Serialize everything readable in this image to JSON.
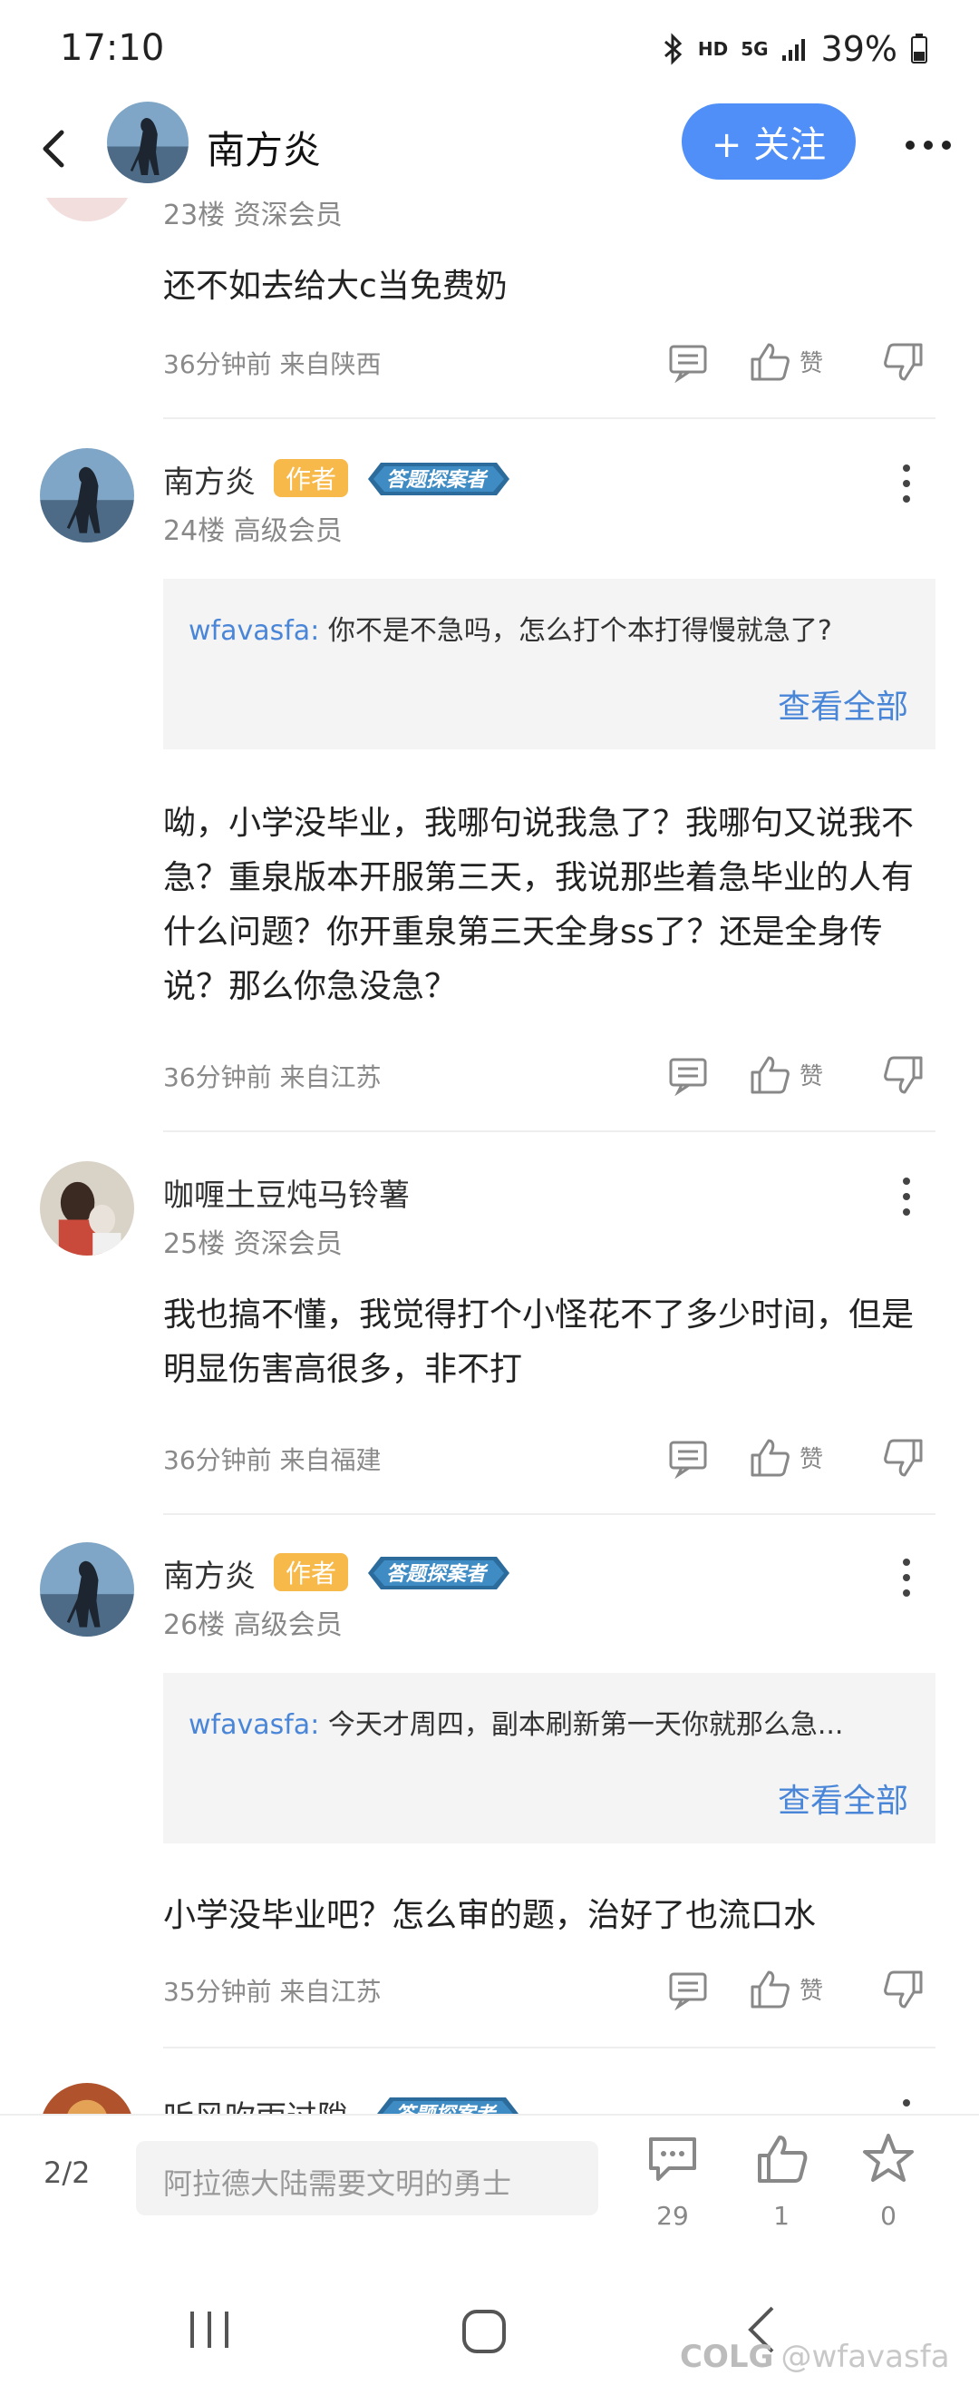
{
  "status": {
    "time": "17:10",
    "hd": "HD",
    "network": "5G",
    "battery": "39%"
  },
  "header": {
    "name": "南方炎",
    "follow_label": "+ 关注"
  },
  "comments": [
    {
      "floor": "23楼 资深会员",
      "body": "还不如去给大c当免费奶",
      "meta": "36分钟前 来自陕西",
      "like_label": "赞"
    },
    {
      "name": "南方炎",
      "author_tag": "作者",
      "badge": "答题探案者",
      "floor": "24楼 高级会员",
      "quote_user": "wfavasfa:",
      "quote_text": "你不是不急吗，怎么打个本打得慢就急了?",
      "view_all": "查看全部",
      "body": "呦，小学没毕业，我哪句说我急了？我哪句又说我不急？重泉版本开服第三天，我说那些着急毕业的人有什么问题？你开重泉第三天全身ss了？还是全身传说？那么你急没急？",
      "meta": "36分钟前 来自江苏",
      "like_label": "赞"
    },
    {
      "name": "咖喱土豆炖马铃薯",
      "floor": "25楼 资深会员",
      "body": "我也搞不懂，我觉得打个小怪花不了多少时间，但是明显伤害高很多，非不打",
      "meta": "36分钟前 来自福建",
      "like_label": "赞"
    },
    {
      "name": "南方炎",
      "author_tag": "作者",
      "badge": "答题探案者",
      "floor": "26楼 高级会员",
      "quote_user": "wfavasfa:",
      "quote_text": "今天才周四，副本刷新第一天你就那么急...",
      "view_all": "查看全部",
      "body": "小学没毕业吧？怎么审的题，治好了也流口水",
      "meta": "35分钟前 来自江苏",
      "like_label": "赞"
    },
    {
      "name": "听风吹雨过隙",
      "badge": "答题探案者"
    }
  ],
  "bottombar": {
    "page": "2/2",
    "input_placeholder": "阿拉德大陆需要文明的勇士",
    "comment_count": "29",
    "like_count": "1",
    "fav_count": "0"
  },
  "watermark": {
    "logo": "COLG",
    "handle": "@wfavasfa"
  },
  "colors": {
    "accent": "#4f8ff7",
    "link": "#4a86d8",
    "author_tag": "#f7b94a"
  }
}
